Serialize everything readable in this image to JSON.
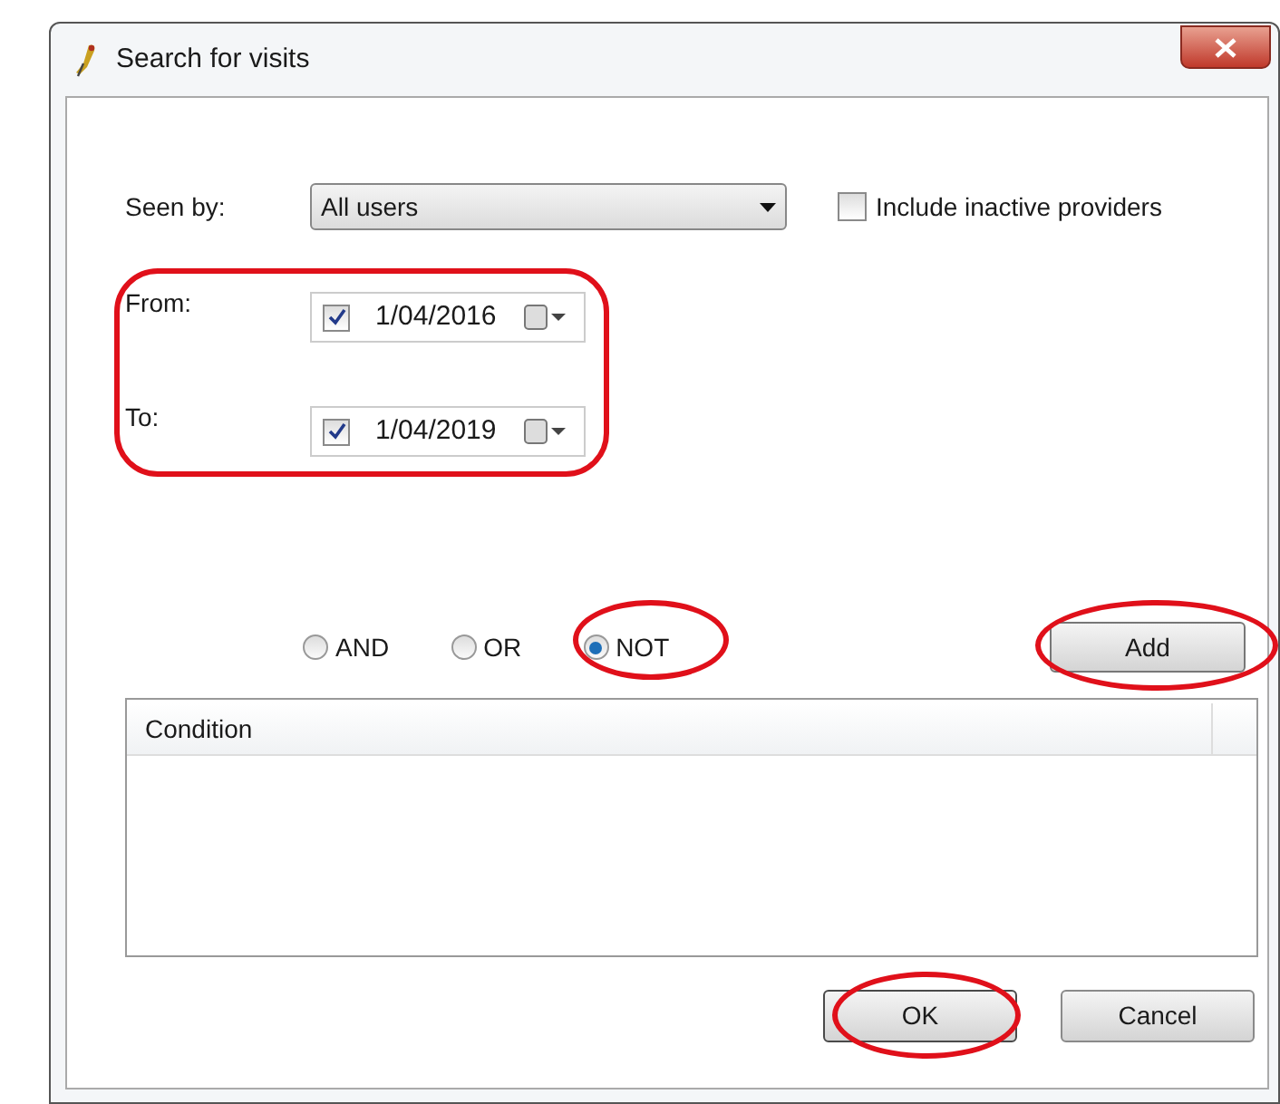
{
  "window": {
    "title": "Search for visits"
  },
  "seen_by": {
    "label": "Seen by:",
    "value": "All users"
  },
  "include_inactive": {
    "label": "Include inactive providers",
    "checked": false
  },
  "dates": [
    {
      "label": "From:",
      "checked": true,
      "value": "1/04/2016"
    },
    {
      "label": "To:",
      "checked": true,
      "value": "1/04/2019"
    }
  ],
  "operators": [
    {
      "label": "AND",
      "selected": false
    },
    {
      "label": "OR",
      "selected": false
    },
    {
      "label": "NOT",
      "selected": true
    }
  ],
  "add_button": "Add",
  "conditions": {
    "columns": [
      "Condition"
    ]
  },
  "buttons": [
    {
      "label": "OK",
      "kind": "ok"
    },
    {
      "label": "Cancel",
      "kind": "cancel"
    }
  ]
}
